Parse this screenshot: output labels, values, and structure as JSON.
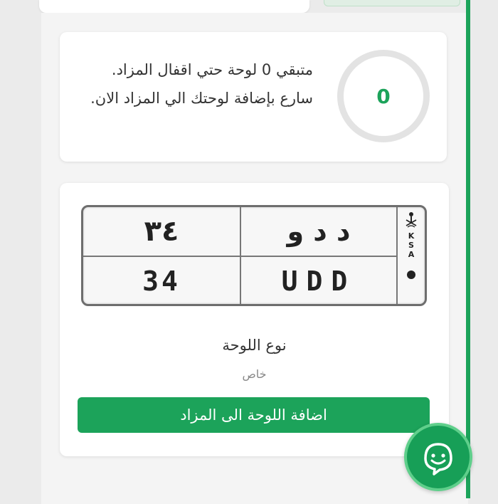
{
  "counter": {
    "value": "0",
    "remaining_text": "متبقي 0 لوحة حتي اقفال المزاد.",
    "cta_text": "سارع بإضافة لوحتك الي المزاد الان."
  },
  "plate": {
    "arabic_number": "٣٤",
    "arabic_letters": "د د و",
    "english_number": "34",
    "english_letters": "UDD",
    "country_code_letters": [
      "K",
      "S",
      "A"
    ]
  },
  "plate_type": {
    "label": "نوع اللوحة",
    "value": "خاص"
  },
  "actions": {
    "add_plate_label": "اضافة اللوحة الى المزاد"
  },
  "colors": {
    "accent": "#1ca35a",
    "ring_track": "#e3e3e3"
  }
}
